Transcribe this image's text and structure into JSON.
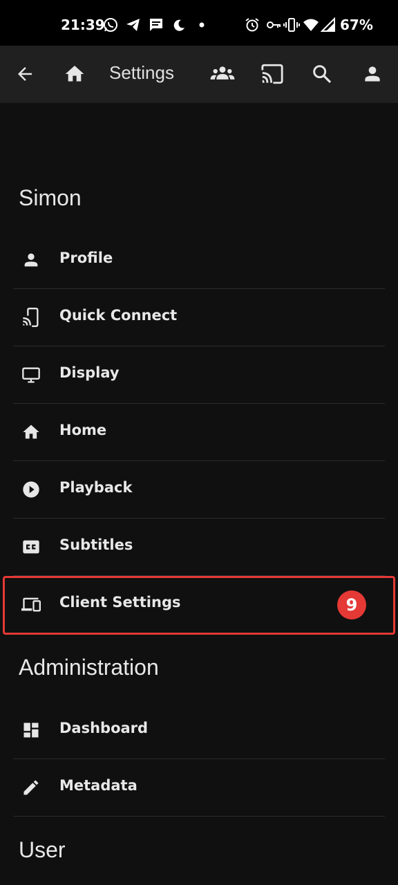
{
  "status_bar": {
    "time": "21:39",
    "battery": "67%",
    "icons": [
      "whatsapp-icon",
      "telegram-icon",
      "message-icon",
      "moon-icon",
      "dot-icon",
      "alarm-icon",
      "key-icon",
      "vibrate-icon",
      "wifi-icon",
      "signal-icon"
    ]
  },
  "app_bar": {
    "title": "Settings",
    "icons": [
      "back-arrow-icon",
      "home-icon",
      "group-icon",
      "cast-icon",
      "search-icon",
      "account-icon"
    ]
  },
  "sections": {
    "user_name": "Simon",
    "administration": "Administration",
    "user": "User"
  },
  "user_items": [
    {
      "label": "Profile",
      "icon": "person-icon"
    },
    {
      "label": "Quick Connect",
      "icon": "cast-device-icon"
    },
    {
      "label": "Display",
      "icon": "monitor-icon"
    },
    {
      "label": "Home",
      "icon": "home-icon"
    },
    {
      "label": "Playback",
      "icon": "play-circle-icon"
    },
    {
      "label": "Subtitles",
      "icon": "closed-caption-icon"
    },
    {
      "label": "Client Settings",
      "icon": "devices-icon"
    }
  ],
  "admin_items": [
    {
      "label": "Dashboard",
      "icon": "dashboard-icon"
    },
    {
      "label": "Metadata",
      "icon": "pencil-icon"
    }
  ],
  "annotation": {
    "badge_number": "9",
    "highlight_color": "#e53935"
  },
  "colors": {
    "background": "#101010",
    "app_bar": "#202020",
    "status_bar": "#000000",
    "text": "#e8e8e8"
  }
}
